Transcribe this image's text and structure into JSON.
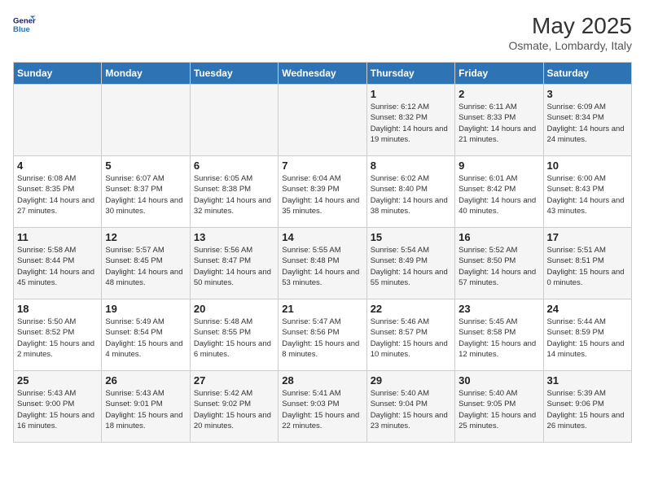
{
  "header": {
    "logo_line1": "General",
    "logo_line2": "Blue",
    "month_year": "May 2025",
    "location": "Osmate, Lombardy, Italy"
  },
  "days_of_week": [
    "Sunday",
    "Monday",
    "Tuesday",
    "Wednesday",
    "Thursday",
    "Friday",
    "Saturday"
  ],
  "weeks": [
    [
      {
        "day": "",
        "info": ""
      },
      {
        "day": "",
        "info": ""
      },
      {
        "day": "",
        "info": ""
      },
      {
        "day": "",
        "info": ""
      },
      {
        "day": "1",
        "info": "Sunrise: 6:12 AM\nSunset: 8:32 PM\nDaylight: 14 hours and 19 minutes."
      },
      {
        "day": "2",
        "info": "Sunrise: 6:11 AM\nSunset: 8:33 PM\nDaylight: 14 hours and 21 minutes."
      },
      {
        "day": "3",
        "info": "Sunrise: 6:09 AM\nSunset: 8:34 PM\nDaylight: 14 hours and 24 minutes."
      }
    ],
    [
      {
        "day": "4",
        "info": "Sunrise: 6:08 AM\nSunset: 8:35 PM\nDaylight: 14 hours and 27 minutes."
      },
      {
        "day": "5",
        "info": "Sunrise: 6:07 AM\nSunset: 8:37 PM\nDaylight: 14 hours and 30 minutes."
      },
      {
        "day": "6",
        "info": "Sunrise: 6:05 AM\nSunset: 8:38 PM\nDaylight: 14 hours and 32 minutes."
      },
      {
        "day": "7",
        "info": "Sunrise: 6:04 AM\nSunset: 8:39 PM\nDaylight: 14 hours and 35 minutes."
      },
      {
        "day": "8",
        "info": "Sunrise: 6:02 AM\nSunset: 8:40 PM\nDaylight: 14 hours and 38 minutes."
      },
      {
        "day": "9",
        "info": "Sunrise: 6:01 AM\nSunset: 8:42 PM\nDaylight: 14 hours and 40 minutes."
      },
      {
        "day": "10",
        "info": "Sunrise: 6:00 AM\nSunset: 8:43 PM\nDaylight: 14 hours and 43 minutes."
      }
    ],
    [
      {
        "day": "11",
        "info": "Sunrise: 5:58 AM\nSunset: 8:44 PM\nDaylight: 14 hours and 45 minutes."
      },
      {
        "day": "12",
        "info": "Sunrise: 5:57 AM\nSunset: 8:45 PM\nDaylight: 14 hours and 48 minutes."
      },
      {
        "day": "13",
        "info": "Sunrise: 5:56 AM\nSunset: 8:47 PM\nDaylight: 14 hours and 50 minutes."
      },
      {
        "day": "14",
        "info": "Sunrise: 5:55 AM\nSunset: 8:48 PM\nDaylight: 14 hours and 53 minutes."
      },
      {
        "day": "15",
        "info": "Sunrise: 5:54 AM\nSunset: 8:49 PM\nDaylight: 14 hours and 55 minutes."
      },
      {
        "day": "16",
        "info": "Sunrise: 5:52 AM\nSunset: 8:50 PM\nDaylight: 14 hours and 57 minutes."
      },
      {
        "day": "17",
        "info": "Sunrise: 5:51 AM\nSunset: 8:51 PM\nDaylight: 15 hours and 0 minutes."
      }
    ],
    [
      {
        "day": "18",
        "info": "Sunrise: 5:50 AM\nSunset: 8:52 PM\nDaylight: 15 hours and 2 minutes."
      },
      {
        "day": "19",
        "info": "Sunrise: 5:49 AM\nSunset: 8:54 PM\nDaylight: 15 hours and 4 minutes."
      },
      {
        "day": "20",
        "info": "Sunrise: 5:48 AM\nSunset: 8:55 PM\nDaylight: 15 hours and 6 minutes."
      },
      {
        "day": "21",
        "info": "Sunrise: 5:47 AM\nSunset: 8:56 PM\nDaylight: 15 hours and 8 minutes."
      },
      {
        "day": "22",
        "info": "Sunrise: 5:46 AM\nSunset: 8:57 PM\nDaylight: 15 hours and 10 minutes."
      },
      {
        "day": "23",
        "info": "Sunrise: 5:45 AM\nSunset: 8:58 PM\nDaylight: 15 hours and 12 minutes."
      },
      {
        "day": "24",
        "info": "Sunrise: 5:44 AM\nSunset: 8:59 PM\nDaylight: 15 hours and 14 minutes."
      }
    ],
    [
      {
        "day": "25",
        "info": "Sunrise: 5:43 AM\nSunset: 9:00 PM\nDaylight: 15 hours and 16 minutes."
      },
      {
        "day": "26",
        "info": "Sunrise: 5:43 AM\nSunset: 9:01 PM\nDaylight: 15 hours and 18 minutes."
      },
      {
        "day": "27",
        "info": "Sunrise: 5:42 AM\nSunset: 9:02 PM\nDaylight: 15 hours and 20 minutes."
      },
      {
        "day": "28",
        "info": "Sunrise: 5:41 AM\nSunset: 9:03 PM\nDaylight: 15 hours and 22 minutes."
      },
      {
        "day": "29",
        "info": "Sunrise: 5:40 AM\nSunset: 9:04 PM\nDaylight: 15 hours and 23 minutes."
      },
      {
        "day": "30",
        "info": "Sunrise: 5:40 AM\nSunset: 9:05 PM\nDaylight: 15 hours and 25 minutes."
      },
      {
        "day": "31",
        "info": "Sunrise: 5:39 AM\nSunset: 9:06 PM\nDaylight: 15 hours and 26 minutes."
      }
    ]
  ]
}
